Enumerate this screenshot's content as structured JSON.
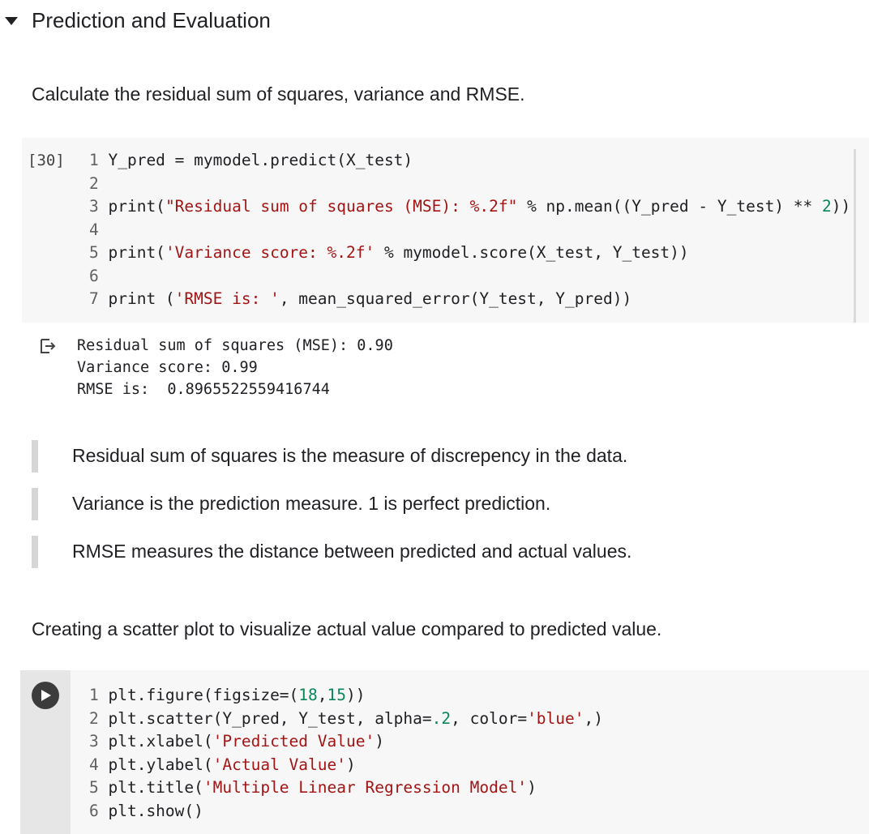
{
  "section": {
    "title": "Prediction and Evaluation"
  },
  "text_cell_1": "Calculate the residual sum of squares, variance and RMSE.",
  "code_cell_1": {
    "exec_count": "[30]",
    "lines": [
      {
        "n": "1",
        "parts": [
          {
            "t": "Y_pred = mymodel.predict(X_test)",
            "c": ""
          }
        ]
      },
      {
        "n": "2",
        "parts": []
      },
      {
        "n": "3",
        "parts": [
          {
            "t": "print(",
            "c": ""
          },
          {
            "t": "\"Residual sum of squares (MSE): %.2f\"",
            "c": "str"
          },
          {
            "t": " % np.mean((Y_pred - Y_test) ** ",
            "c": ""
          },
          {
            "t": "2",
            "c": "num"
          },
          {
            "t": "))",
            "c": ""
          }
        ]
      },
      {
        "n": "4",
        "parts": []
      },
      {
        "n": "5",
        "parts": [
          {
            "t": "print(",
            "c": ""
          },
          {
            "t": "'Variance score: %.2f'",
            "c": "str"
          },
          {
            "t": " % mymodel.score(X_test, Y_test))",
            "c": ""
          }
        ]
      },
      {
        "n": "6",
        "parts": []
      },
      {
        "n": "7",
        "parts": [
          {
            "t": "print (",
            "c": ""
          },
          {
            "t": "'RMSE is: '",
            "c": "str"
          },
          {
            "t": ", mean_squared_error(Y_test, Y_pred))",
            "c": ""
          }
        ]
      }
    ]
  },
  "output_1": {
    "lines": [
      "Residual sum of squares (MSE): 0.90",
      "Variance score: 0.99",
      "RMSE is:  0.8965522559416744"
    ]
  },
  "quotes": [
    "Residual sum of squares is the measure of discrepency in the data.",
    "Variance is the prediction measure. 1 is perfect prediction.",
    "RMSE measures the distance between predicted and actual values."
  ],
  "text_cell_2": "Creating a scatter plot to visualize actual value compared to predicted value.",
  "code_cell_2": {
    "lines": [
      {
        "n": "1",
        "parts": [
          {
            "t": "plt.figure(figsize=(",
            "c": ""
          },
          {
            "t": "18",
            "c": "num"
          },
          {
            "t": ",",
            "c": ""
          },
          {
            "t": "15",
            "c": "num"
          },
          {
            "t": "))",
            "c": ""
          }
        ]
      },
      {
        "n": "2",
        "parts": [
          {
            "t": "plt.scatter(Y_pred, Y_test, alpha=",
            "c": ""
          },
          {
            "t": ".2",
            "c": "num"
          },
          {
            "t": ", color=",
            "c": ""
          },
          {
            "t": "'blue'",
            "c": "str"
          },
          {
            "t": ",)",
            "c": ""
          }
        ]
      },
      {
        "n": "3",
        "parts": [
          {
            "t": "plt.xlabel(",
            "c": ""
          },
          {
            "t": "'Predicted Value'",
            "c": "str"
          },
          {
            "t": ")",
            "c": ""
          }
        ]
      },
      {
        "n": "4",
        "parts": [
          {
            "t": "plt.ylabel(",
            "c": ""
          },
          {
            "t": "'Actual Value'",
            "c": "str"
          },
          {
            "t": ")",
            "c": ""
          }
        ]
      },
      {
        "n": "5",
        "parts": [
          {
            "t": "plt.title(",
            "c": ""
          },
          {
            "t": "'Multiple Linear Regression Model'",
            "c": "str"
          },
          {
            "t": ")",
            "c": ""
          }
        ]
      },
      {
        "n": "6",
        "parts": [
          {
            "t": "plt.show()",
            "c": ""
          }
        ]
      }
    ]
  },
  "icons": {
    "collapse": "caret-down-icon",
    "output": "output-arrow-icon",
    "run": "play-icon"
  },
  "colors": {
    "string": "#a31515",
    "number": "#098658",
    "cell_bg": "#f7f7f7"
  }
}
